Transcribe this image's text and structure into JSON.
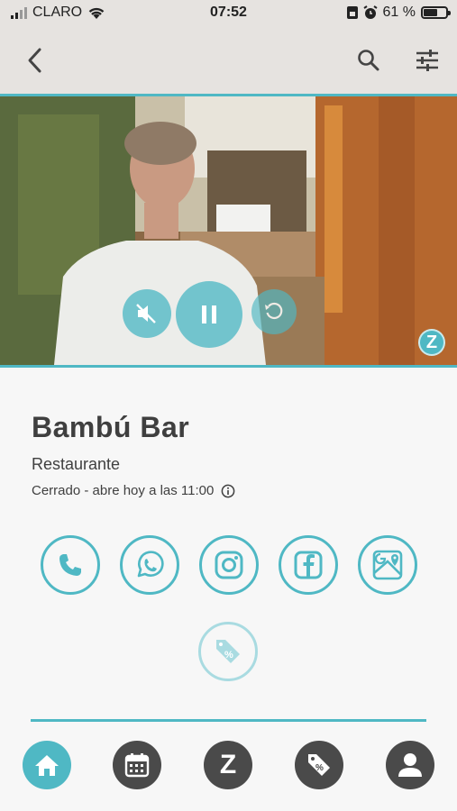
{
  "status_bar": {
    "carrier": "CLARO",
    "time": "07:52",
    "battery": "61 %",
    "battery_level": 0.61
  },
  "header": {
    "back_icon": "chevron-left-icon",
    "search_icon": "search-icon",
    "filter_icon": "sliders-icon"
  },
  "video": {
    "mute_icon": "volume-off-icon",
    "pause_icon": "pause-icon",
    "replay_icon": "replay-icon",
    "badge": "Z"
  },
  "business": {
    "name": "Bambú Bar",
    "category": "Restaurante",
    "hours": "Cerrado - abre hoy a las 11:00"
  },
  "actions": [
    {
      "icon": "phone-icon"
    },
    {
      "icon": "whatsapp-icon"
    },
    {
      "icon": "instagram-icon"
    },
    {
      "icon": "facebook-icon"
    },
    {
      "icon": "google-maps-icon"
    }
  ],
  "promo": {
    "icon": "discount-tag-icon"
  },
  "nav": {
    "items": [
      {
        "icon": "home-icon",
        "active": true
      },
      {
        "icon": "calendar-icon"
      },
      {
        "icon": "z-logo-icon",
        "label": "Z"
      },
      {
        "icon": "discount-tag-icon"
      },
      {
        "icon": "user-icon"
      }
    ]
  },
  "colors": {
    "accent": "#4fb8c4",
    "nav_dark": "#4a4a4a",
    "text": "#404040"
  }
}
